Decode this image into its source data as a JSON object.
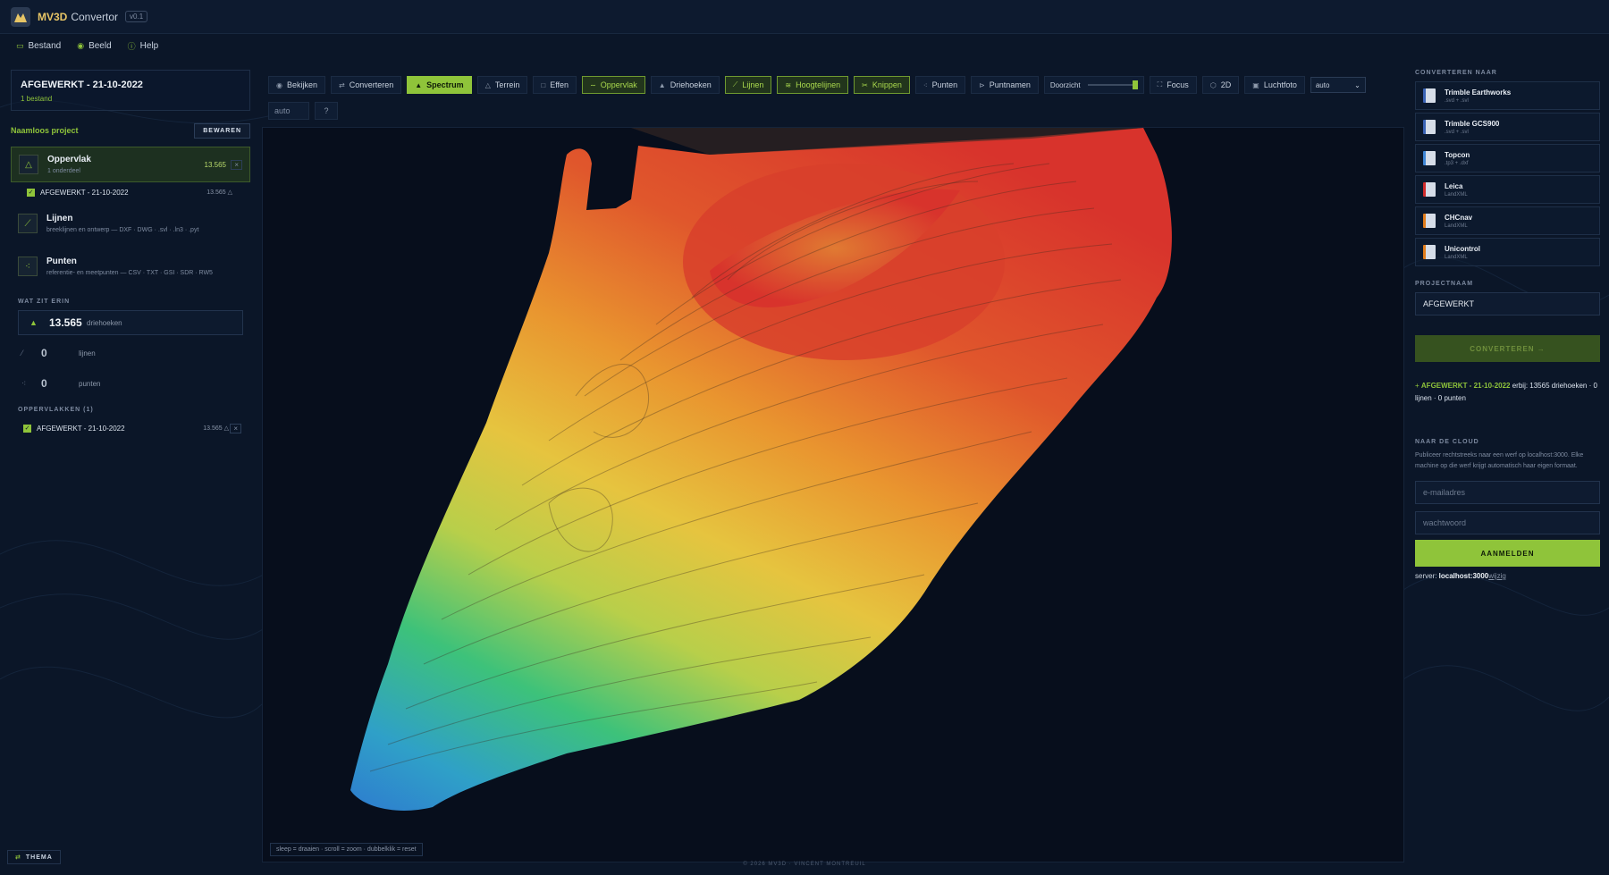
{
  "app": {
    "name": "MV3D",
    "subtitle": "Convertor",
    "version": "v0.1"
  },
  "menu": [
    {
      "label": "Bestand",
      "icon": "folder-icon"
    },
    {
      "label": "Beeld",
      "icon": "eye-icon"
    },
    {
      "label": "Help",
      "icon": "help-icon"
    }
  ],
  "left": {
    "title": "AFGEWERKT - 21-10-2022",
    "files": "1 bestand",
    "project_name": "Naamloos project",
    "save_label": "BEWAREN",
    "surface": {
      "name": "Oppervlak",
      "desc": "1 onderdeel",
      "count": "13.565",
      "close": "×"
    },
    "surface_item": {
      "name": "AFGEWERKT - 21-10-2022",
      "count": "13.565 △"
    },
    "lines": {
      "name": "Lijnen",
      "desc": "breeklijnen en ontwerp — DXF · DWG · .svl · .ln3 · .pyt"
    },
    "points": {
      "name": "Punten",
      "desc": "referentie- en meetpunten — CSV · TXT · GSI · SDR · RW5"
    },
    "contents_label": "WAT ZIT ERIN",
    "stats": [
      {
        "num": "13.565",
        "label": "driehoeken"
      },
      {
        "num": "0",
        "label": "lijnen"
      },
      {
        "num": "0",
        "label": "punten"
      }
    ],
    "surfaces_label": "OPPERVLAKKEN (1)",
    "surfaces_item": {
      "name": "AFGEWERKT - 21-10-2022",
      "count": "13.565 △",
      "close": "×"
    }
  },
  "theme_label": "THEMA",
  "toolbar": {
    "view": "Bekijken",
    "convert": "Converteren",
    "spectrum": "Spectrum",
    "terrain": "Terrein",
    "flat": "Effen",
    "surface": "Oppervlak",
    "triangles": "Driehoeken",
    "lines": "Lijnen",
    "contours": "Hoogtelijnen",
    "clip": "Knippen",
    "points": "Punten",
    "point_names": "Puntnamen",
    "transparency": "Doorzicht",
    "transparency_level": 1.0,
    "focus": "Focus",
    "mode_2d": "2D",
    "aerial": "Luchtfoto",
    "select_value": "auto",
    "auto_value": "auto",
    "help": "?"
  },
  "viewport": {
    "hint": "sleep = draaien · scroll = zoom · dubbelklik = reset"
  },
  "copyright": "© 2026 MV3D · VINCENT MONTREUIL",
  "right": {
    "convert_to_label": "CONVERTEREN NAAR",
    "formats": [
      {
        "name": "Trimble Earthworks",
        "ext": ".svd + .svl",
        "color": "#3a63b5"
      },
      {
        "name": "Trimble GCS900",
        "ext": ".svd + .svl",
        "color": "#3a63b5"
      },
      {
        "name": "Topcon",
        "ext": ".tp3 + .dxf",
        "color": "#3f86d6"
      },
      {
        "name": "Leica",
        "ext": "LandXML",
        "color": "#d12b2b"
      },
      {
        "name": "CHCnav",
        "ext": "LandXML",
        "color": "#e07b1a"
      },
      {
        "name": "Unicontrol",
        "ext": "LandXML",
        "color": "#e07b1a"
      }
    ],
    "project_label": "PROJECTNAAM",
    "project_value": "AFGEWERKT",
    "convert_button": "CONVERTEREN →",
    "summary_prefix": "+ ",
    "summary_name": "AFGEWERKT - 21-10-2022",
    "summary_rest": " erbij: 13565 driehoeken · 0 lijnen · 0 punten",
    "cloud_label": "NAAR DE CLOUD",
    "cloud_desc": "Publiceer rechtstreeks naar een werf op localhost:3000. Elke machine op die werf krijgt automatisch haar eigen formaat.",
    "email_placeholder": "e-mailadres",
    "password_placeholder": "wachtwoord",
    "login_button": "AANMELDEN",
    "server_prefix": "server: ",
    "server_value": "localhost:3000",
    "server_change": "wijzig"
  }
}
